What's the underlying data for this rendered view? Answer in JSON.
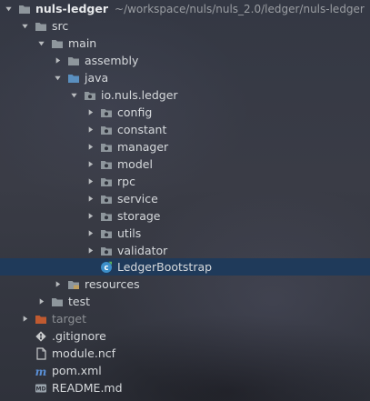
{
  "tree": {
    "root": {
      "label": "nuls-ledger",
      "path": "~/workspace/nuls/nuls_2.0/ledger/nuls-ledger"
    },
    "src": "src",
    "main": "main",
    "assembly": "assembly",
    "java": "java",
    "package": "io.nuls.ledger",
    "packages": [
      "config",
      "constant",
      "manager",
      "model",
      "rpc",
      "service",
      "storage",
      "utils",
      "validator"
    ],
    "bootstrap": "LedgerBootstrap",
    "resources": "resources",
    "test": "test",
    "target": "target",
    "gitignore": ".gitignore",
    "module_ncf": "module.ncf",
    "pom": "pom.xml",
    "readme": "README.md"
  },
  "colors": {
    "folder": "#8e969c",
    "folder_blue": "#5a8fbf",
    "folder_orange": "#c05a30",
    "arrow": "#b9bcbf",
    "selection": "#1f3a5a",
    "class_icon": "#3d8fc9"
  }
}
